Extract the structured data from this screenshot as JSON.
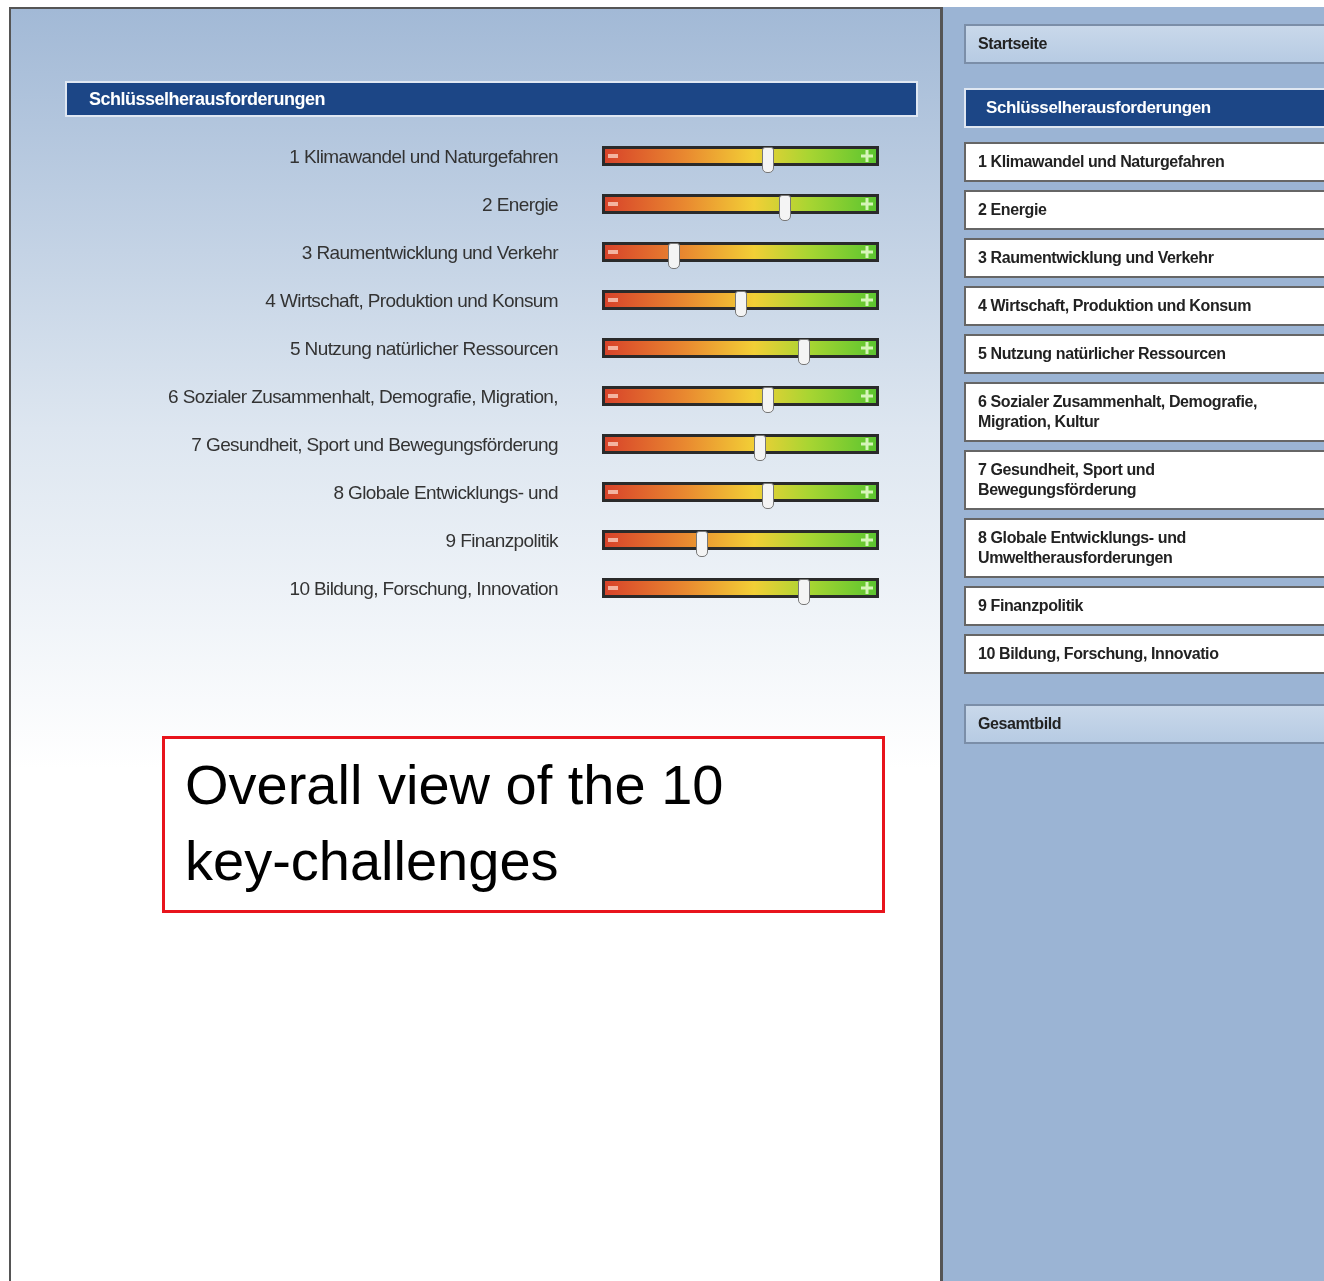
{
  "main": {
    "heading": "Schlüsselherausforderungen",
    "sliders": [
      {
        "label": "1 Klimawandel und Naturgefahren",
        "level": 0.6
      },
      {
        "label": "2 Energie",
        "level": 0.66
      },
      {
        "label": "3 Raumentwicklung und Verkehr",
        "level": 0.26
      },
      {
        "label": "4 Wirtschaft, Produktion und Konsum",
        "level": 0.5
      },
      {
        "label": "5 Nutzung natürlicher Ressourcen",
        "level": 0.73
      },
      {
        "label": "6 Sozialer Zusammenhalt, Demografie, Migration,",
        "level": 0.6
      },
      {
        "label": "7 Gesundheit, Sport und Bewegungsförderung",
        "level": 0.57
      },
      {
        "label": "8 Globale Entwicklungs- und",
        "level": 0.6
      },
      {
        "label": "9 Finanzpolitik",
        "level": 0.36
      },
      {
        "label": "10 Bildung, Forschung, Innovation",
        "level": 0.73
      }
    ],
    "annotation": "Overall view of the 10 key-challenges"
  },
  "sidebar": {
    "items": [
      {
        "label": "Startseite",
        "kind": "link"
      },
      {
        "label": "Schlüsselherausforderungen",
        "kind": "header"
      },
      {
        "label": "1 Klimawandel und Naturgefahren",
        "kind": "topic"
      },
      {
        "label": "2 Energie",
        "kind": "topic"
      },
      {
        "label": "3 Raumentwicklung und Verkehr",
        "kind": "topic"
      },
      {
        "label": "4 Wirtschaft, Produktion und Konsum",
        "kind": "topic"
      },
      {
        "label": "5 Nutzung natürlicher Ressourcen",
        "kind": "topic"
      },
      {
        "label": "6 Sozialer Zusammenhalt, Demografie, Migration, Kultur",
        "kind": "topic"
      },
      {
        "label": "7 Gesundheit, Sport und Bewegungsförderung",
        "kind": "topic"
      },
      {
        "label": "8 Globale Entwicklungs- und Umweltherausforderungen",
        "kind": "topic"
      },
      {
        "label": "9 Finanzpolitik",
        "kind": "topic"
      },
      {
        "label": "10 Bildung, Forschung, Innovatio",
        "kind": "topic"
      },
      {
        "label": "Gesamtbild",
        "kind": "link"
      }
    ]
  }
}
